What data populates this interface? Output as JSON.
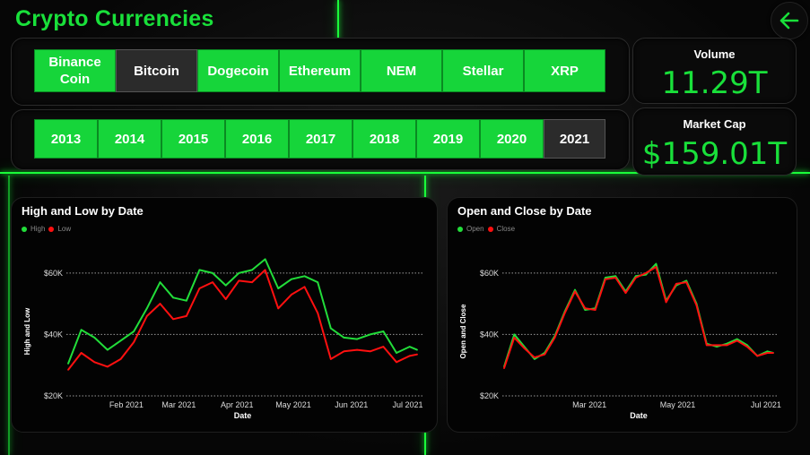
{
  "app": {
    "title": "Crypto Currencies"
  },
  "coins": [
    {
      "label": "Binance Coin",
      "selected": false
    },
    {
      "label": "Bitcoin",
      "selected": true
    },
    {
      "label": "Dogecoin",
      "selected": false
    },
    {
      "label": "Ethereum",
      "selected": false
    },
    {
      "label": "NEM",
      "selected": false
    },
    {
      "label": "Stellar",
      "selected": false
    },
    {
      "label": "XRP",
      "selected": false
    }
  ],
  "years": [
    {
      "label": "2013",
      "selected": false
    },
    {
      "label": "2014",
      "selected": false
    },
    {
      "label": "2015",
      "selected": false
    },
    {
      "label": "2016",
      "selected": false
    },
    {
      "label": "2017",
      "selected": false
    },
    {
      "label": "2018",
      "selected": false
    },
    {
      "label": "2019",
      "selected": false
    },
    {
      "label": "2020",
      "selected": false
    },
    {
      "label": "2021",
      "selected": true
    }
  ],
  "kpi": {
    "volume_label": "Volume",
    "volume_value": "11.29T",
    "marketcap_label": "Market Cap",
    "marketcap_value": "$159.01T"
  },
  "colors": {
    "accent": "#19e03a",
    "green_series": "#22dd3a",
    "red_series": "#ff1010"
  },
  "icons": {
    "back": "arrow-left-icon"
  },
  "chart_data": [
    {
      "type": "line",
      "title": "High and Low by Date",
      "xlabel": "Date",
      "ylabel": "High and Low",
      "x_ticks": [
        "Feb 2021",
        "Mar 2021",
        "Apr 2021",
        "May 2021",
        "Jun 2021",
        "Jul 2021"
      ],
      "y_ticks": [
        "$20K",
        "$40K",
        "$60K"
      ],
      "ylim": [
        20000,
        62000
      ],
      "legend_placement": "top-left",
      "x": [
        "2021-01-01",
        "2021-01-08",
        "2021-01-15",
        "2021-01-22",
        "2021-01-29",
        "2021-02-05",
        "2021-02-12",
        "2021-02-19",
        "2021-02-26",
        "2021-03-05",
        "2021-03-12",
        "2021-03-19",
        "2021-03-26",
        "2021-04-02",
        "2021-04-09",
        "2021-04-16",
        "2021-04-23",
        "2021-04-30",
        "2021-05-07",
        "2021-05-14",
        "2021-05-21",
        "2021-05-28",
        "2021-06-04",
        "2021-06-11",
        "2021-06-18",
        "2021-06-25",
        "2021-07-02",
        "2021-07-06"
      ],
      "series": [
        {
          "name": "High",
          "color": "#22dd3a",
          "values": [
            30500,
            41500,
            39000,
            35000,
            38000,
            41000,
            48500,
            57000,
            52000,
            51000,
            61000,
            60000,
            56000,
            60000,
            61000,
            64500,
            55000,
            58000,
            59000,
            57000,
            42000,
            39000,
            38500,
            40000,
            41000,
            34000,
            36000,
            35000
          ]
        },
        {
          "name": "Low",
          "color": "#ff1010",
          "values": [
            28500,
            34000,
            31000,
            29500,
            32000,
            37500,
            46000,
            50000,
            45000,
            46000,
            55000,
            57000,
            51500,
            57500,
            57000,
            61000,
            48500,
            53000,
            55500,
            47000,
            32000,
            34500,
            35000,
            34500,
            36000,
            31000,
            33000,
            33500
          ]
        }
      ]
    },
    {
      "type": "line",
      "title": "Open and Close by Date",
      "xlabel": "Date",
      "ylabel": "Open and Close",
      "x_ticks": [
        "Mar 2021",
        "May 2021",
        "Jul 2021"
      ],
      "y_ticks": [
        "$20K",
        "$40K",
        "$60K"
      ],
      "ylim": [
        20000,
        62000
      ],
      "legend_placement": "top-left",
      "x": [
        "2021-01-01",
        "2021-01-08",
        "2021-01-15",
        "2021-01-22",
        "2021-01-29",
        "2021-02-05",
        "2021-02-12",
        "2021-02-19",
        "2021-02-26",
        "2021-03-05",
        "2021-03-12",
        "2021-03-19",
        "2021-03-26",
        "2021-04-02",
        "2021-04-09",
        "2021-04-16",
        "2021-04-23",
        "2021-04-30",
        "2021-05-07",
        "2021-05-14",
        "2021-05-21",
        "2021-05-28",
        "2021-06-04",
        "2021-06-11",
        "2021-06-18",
        "2021-06-25",
        "2021-07-02",
        "2021-07-06"
      ],
      "series": [
        {
          "name": "Open",
          "color": "#22dd3a",
          "values": [
            29500,
            40000,
            36000,
            32000,
            34000,
            39500,
            47500,
            54500,
            48000,
            48500,
            58500,
            59000,
            54000,
            59000,
            59500,
            63000,
            51000,
            56000,
            57500,
            50000,
            37000,
            36000,
            37000,
            38500,
            36500,
            33000,
            34500,
            34000
          ]
        },
        {
          "name": "Close",
          "color": "#ff1010",
          "values": [
            29000,
            39000,
            35500,
            32500,
            33500,
            39000,
            47000,
            54000,
            48500,
            48000,
            58000,
            58500,
            53500,
            58500,
            60000,
            62000,
            50500,
            56500,
            57000,
            49500,
            36500,
            36500,
            36500,
            38000,
            36000,
            33000,
            34000,
            34000
          ]
        }
      ]
    }
  ]
}
